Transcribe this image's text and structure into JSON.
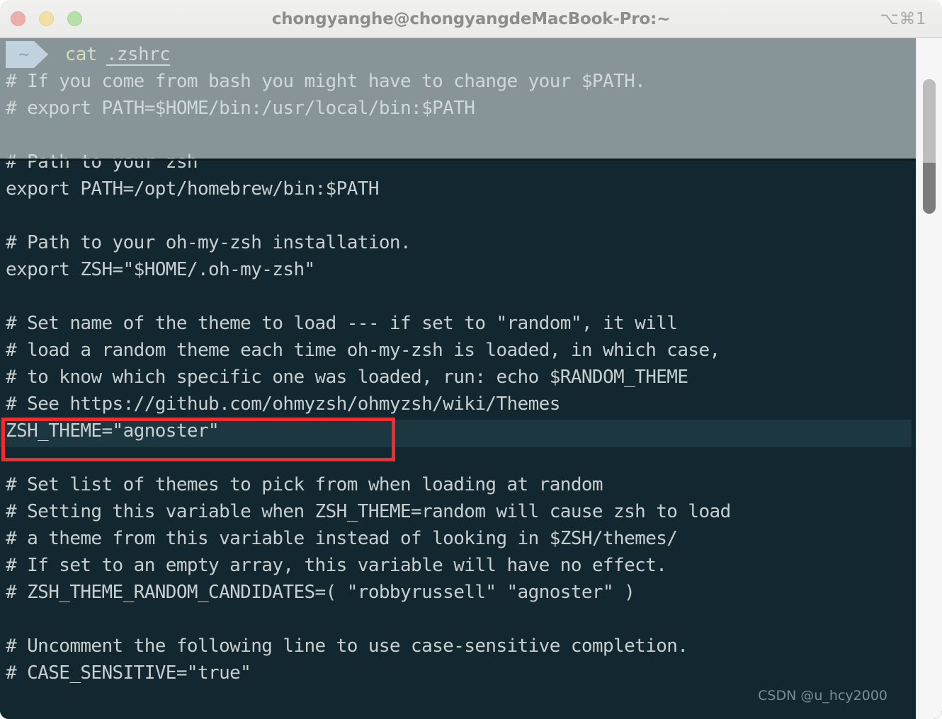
{
  "window": {
    "title": "chongyanghe@chongyangdeMacBook-Pro:~",
    "shortcut": "⌥⌘1",
    "traffic": {
      "close_label": "close",
      "minimize_label": "minimize",
      "maximize_label": "maximize"
    }
  },
  "prompt": {
    "segment": "~",
    "command": "cat",
    "argument": ".zshrc"
  },
  "terminal": {
    "lines": [
      "# If you come from bash you might have to change your $PATH.",
      "# export PATH=$HOME/bin:/usr/local/bin:$PATH",
      "",
      "# Path to your zsh",
      "export PATH=/opt/homebrew/bin:$PATH",
      "",
      "# Path to your oh-my-zsh installation.",
      "export ZSH=\"$HOME/.oh-my-zsh\"",
      "",
      "# Set name of the theme to load --- if set to \"random\", it will",
      "# load a random theme each time oh-my-zsh is loaded, in which case,",
      "# to know which specific one was loaded, run: echo $RANDOM_THEME",
      "# See https://github.com/ohmyzsh/ohmyzsh/wiki/Themes",
      "ZSH_THEME=\"agnoster\"",
      "",
      "# Set list of themes to pick from when loading at random",
      "# Setting this variable when ZSH_THEME=random will cause zsh to load",
      "# a theme from this variable instead of looking in $ZSH/themes/",
      "# If set to an empty array, this variable will have no effect.",
      "# ZSH_THEME_RANDOM_CANDIDATES=( \"robbyrussell\" \"agnoster\" )",
      "",
      "# Uncomment the following line to use case-sensitive completion.",
      "# CASE_SENSITIVE=\"true\""
    ],
    "highlighted_line": "ZSH_THEME=\"agnoster\"",
    "highlighted_line_index": 13
  },
  "watermark": {
    "text": "CSDN @u_hcy2000"
  },
  "colors": {
    "terminal_background": "#12272f",
    "terminal_text": "#c8cfd0",
    "prompt_segment_bg": "#a6c4e0",
    "prompt_command": "#d7d884",
    "annotation_red": "#f22c2c",
    "selection_band": "#1d3740",
    "titlebar_bg": "#eaeae9",
    "traffic_close": "#eeafab",
    "traffic_minimize": "#f2dfa4",
    "traffic_maximize": "#b6dfa9"
  }
}
